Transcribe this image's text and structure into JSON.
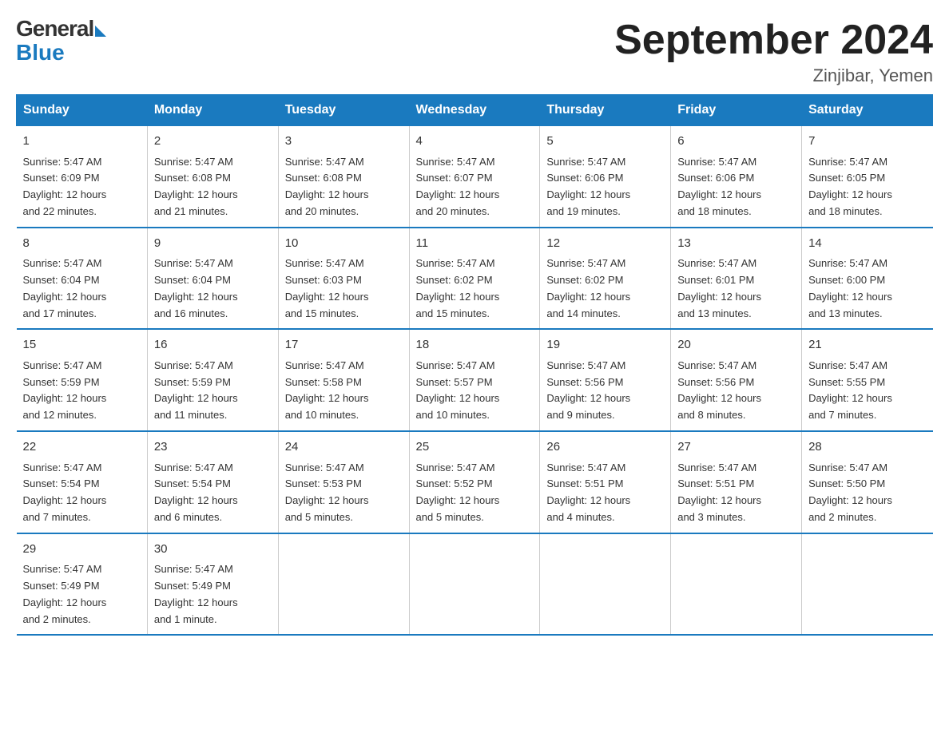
{
  "header": {
    "logo": {
      "general": "General",
      "blue": "Blue"
    },
    "title": "September 2024",
    "location": "Zinjibar, Yemen"
  },
  "calendar": {
    "days_of_week": [
      "Sunday",
      "Monday",
      "Tuesday",
      "Wednesday",
      "Thursday",
      "Friday",
      "Saturday"
    ],
    "weeks": [
      [
        {
          "day": "1",
          "sunrise": "5:47 AM",
          "sunset": "6:09 PM",
          "daylight": "12 hours and 22 minutes."
        },
        {
          "day": "2",
          "sunrise": "5:47 AM",
          "sunset": "6:08 PM",
          "daylight": "12 hours and 21 minutes."
        },
        {
          "day": "3",
          "sunrise": "5:47 AM",
          "sunset": "6:08 PM",
          "daylight": "12 hours and 20 minutes."
        },
        {
          "day": "4",
          "sunrise": "5:47 AM",
          "sunset": "6:07 PM",
          "daylight": "12 hours and 20 minutes."
        },
        {
          "day": "5",
          "sunrise": "5:47 AM",
          "sunset": "6:06 PM",
          "daylight": "12 hours and 19 minutes."
        },
        {
          "day": "6",
          "sunrise": "5:47 AM",
          "sunset": "6:06 PM",
          "daylight": "12 hours and 18 minutes."
        },
        {
          "day": "7",
          "sunrise": "5:47 AM",
          "sunset": "6:05 PM",
          "daylight": "12 hours and 18 minutes."
        }
      ],
      [
        {
          "day": "8",
          "sunrise": "5:47 AM",
          "sunset": "6:04 PM",
          "daylight": "12 hours and 17 minutes."
        },
        {
          "day": "9",
          "sunrise": "5:47 AM",
          "sunset": "6:04 PM",
          "daylight": "12 hours and 16 minutes."
        },
        {
          "day": "10",
          "sunrise": "5:47 AM",
          "sunset": "6:03 PM",
          "daylight": "12 hours and 15 minutes."
        },
        {
          "day": "11",
          "sunrise": "5:47 AM",
          "sunset": "6:02 PM",
          "daylight": "12 hours and 15 minutes."
        },
        {
          "day": "12",
          "sunrise": "5:47 AM",
          "sunset": "6:02 PM",
          "daylight": "12 hours and 14 minutes."
        },
        {
          "day": "13",
          "sunrise": "5:47 AM",
          "sunset": "6:01 PM",
          "daylight": "12 hours and 13 minutes."
        },
        {
          "day": "14",
          "sunrise": "5:47 AM",
          "sunset": "6:00 PM",
          "daylight": "12 hours and 13 minutes."
        }
      ],
      [
        {
          "day": "15",
          "sunrise": "5:47 AM",
          "sunset": "5:59 PM",
          "daylight": "12 hours and 12 minutes."
        },
        {
          "day": "16",
          "sunrise": "5:47 AM",
          "sunset": "5:59 PM",
          "daylight": "12 hours and 11 minutes."
        },
        {
          "day": "17",
          "sunrise": "5:47 AM",
          "sunset": "5:58 PM",
          "daylight": "12 hours and 10 minutes."
        },
        {
          "day": "18",
          "sunrise": "5:47 AM",
          "sunset": "5:57 PM",
          "daylight": "12 hours and 10 minutes."
        },
        {
          "day": "19",
          "sunrise": "5:47 AM",
          "sunset": "5:56 PM",
          "daylight": "12 hours and 9 minutes."
        },
        {
          "day": "20",
          "sunrise": "5:47 AM",
          "sunset": "5:56 PM",
          "daylight": "12 hours and 8 minutes."
        },
        {
          "day": "21",
          "sunrise": "5:47 AM",
          "sunset": "5:55 PM",
          "daylight": "12 hours and 7 minutes."
        }
      ],
      [
        {
          "day": "22",
          "sunrise": "5:47 AM",
          "sunset": "5:54 PM",
          "daylight": "12 hours and 7 minutes."
        },
        {
          "day": "23",
          "sunrise": "5:47 AM",
          "sunset": "5:54 PM",
          "daylight": "12 hours and 6 minutes."
        },
        {
          "day": "24",
          "sunrise": "5:47 AM",
          "sunset": "5:53 PM",
          "daylight": "12 hours and 5 minutes."
        },
        {
          "day": "25",
          "sunrise": "5:47 AM",
          "sunset": "5:52 PM",
          "daylight": "12 hours and 5 minutes."
        },
        {
          "day": "26",
          "sunrise": "5:47 AM",
          "sunset": "5:51 PM",
          "daylight": "12 hours and 4 minutes."
        },
        {
          "day": "27",
          "sunrise": "5:47 AM",
          "sunset": "5:51 PM",
          "daylight": "12 hours and 3 minutes."
        },
        {
          "day": "28",
          "sunrise": "5:47 AM",
          "sunset": "5:50 PM",
          "daylight": "12 hours and 2 minutes."
        }
      ],
      [
        {
          "day": "29",
          "sunrise": "5:47 AM",
          "sunset": "5:49 PM",
          "daylight": "12 hours and 2 minutes."
        },
        {
          "day": "30",
          "sunrise": "5:47 AM",
          "sunset": "5:49 PM",
          "daylight": "12 hours and 1 minute."
        },
        null,
        null,
        null,
        null,
        null
      ]
    ]
  }
}
